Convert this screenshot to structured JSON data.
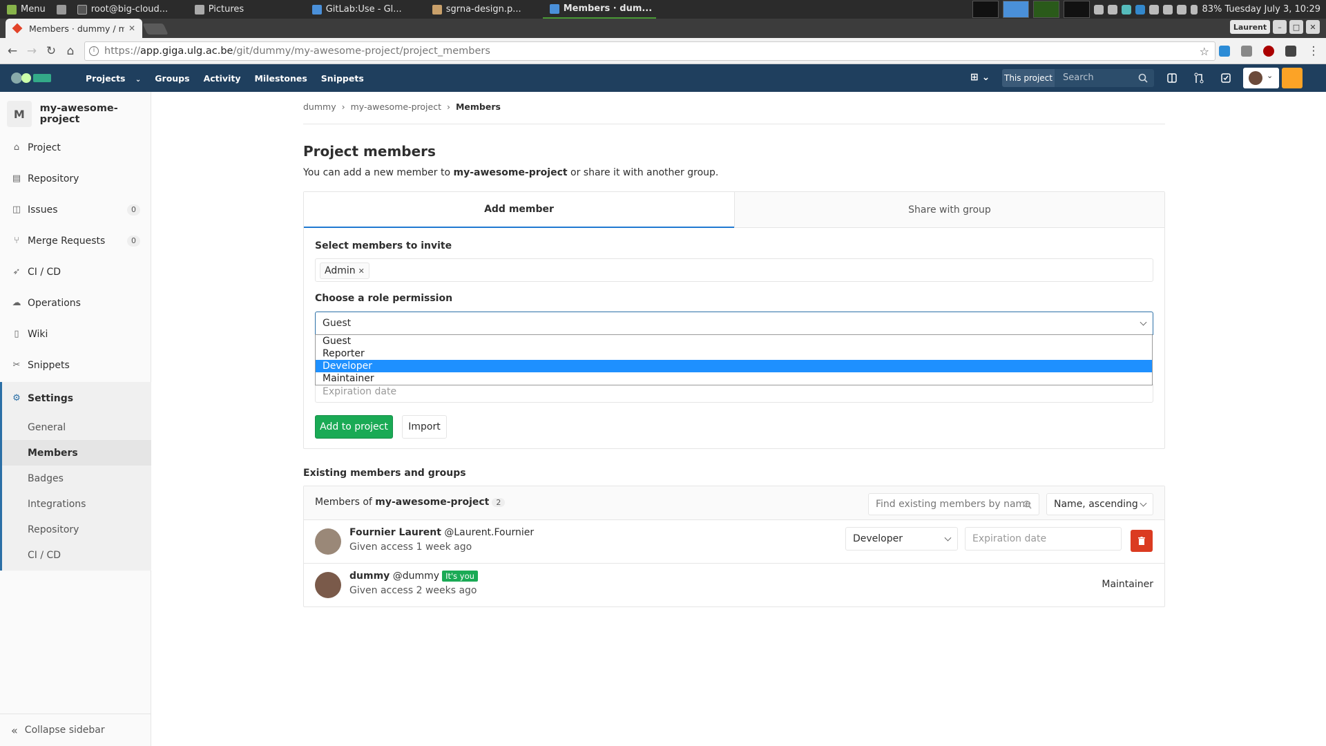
{
  "os_bar": {
    "menu_label": "Menu",
    "tasks": [
      "root@big-cloud...",
      "Pictures",
      "GitLab:Use - Gl...",
      "sgrna-design.p...",
      "Members · dum..."
    ],
    "status": "83%  Tuesday July  3, 10:29",
    "user_badge": "Laurent"
  },
  "browser": {
    "tab_title": "Members · dummy / my",
    "url_prefix": "https://",
    "url_host": "app.giga.ulg.ac.be",
    "url_path": "/git/dummy/my-awesome-project/project_members"
  },
  "header": {
    "nav": [
      "Projects",
      "Groups",
      "Activity",
      "Milestones",
      "Snippets"
    ],
    "this_project": "This project",
    "search_placeholder": "Search"
  },
  "sidebar": {
    "avatar_letter": "M",
    "project_name": "my-awesome-project",
    "items": [
      {
        "label": "Project",
        "icon": "home-icon"
      },
      {
        "label": "Repository",
        "icon": "book-icon"
      },
      {
        "label": "Issues",
        "icon": "issues-icon",
        "badge": "0"
      },
      {
        "label": "Merge Requests",
        "icon": "merge-request-icon",
        "badge": "0"
      },
      {
        "label": "CI / CD",
        "icon": "rocket-icon"
      },
      {
        "label": "Operations",
        "icon": "cloud-gear-icon"
      },
      {
        "label": "Wiki",
        "icon": "book-open-icon"
      },
      {
        "label": "Snippets",
        "icon": "scissors-icon"
      }
    ],
    "settings_label": "Settings",
    "settings_items": [
      "General",
      "Members",
      "Badges",
      "Integrations",
      "Repository",
      "CI / CD"
    ],
    "active_settings_item": "Members",
    "collapse_label": "Collapse sidebar"
  },
  "breadcrumb": [
    "dummy",
    "my-awesome-project",
    "Members"
  ],
  "page": {
    "title": "Project members",
    "desc_before": "You can add a new member to ",
    "desc_project": "my-awesome-project",
    "desc_after": " or share it with another group."
  },
  "tabs": [
    "Add member",
    "Share with group"
  ],
  "form": {
    "select_label": "Select members to invite",
    "selected_token": "Admin",
    "role_label": "Choose a role permission",
    "role_value": "Guest",
    "role_options": [
      "Guest",
      "Reporter",
      "Developer",
      "Maintainer"
    ],
    "highlighted_option": "Developer",
    "expiration_placeholder": "Expiration date",
    "add_button": "Add to project",
    "import_button": "Import"
  },
  "existing": {
    "section_title": "Existing members and groups",
    "members_of": "Members of ",
    "project": "my-awesome-project",
    "count": "2",
    "find_placeholder": "Find existing members by name",
    "sort_label": "Name, ascending",
    "members": [
      {
        "name": "Fournier Laurent",
        "handle": "@Laurent.Fournier",
        "access": "Given access 1 week ago",
        "role": "Developer",
        "expiration_placeholder": "Expiration date"
      },
      {
        "name": "dummy",
        "handle": "@dummy",
        "you_badge": "It's you",
        "access": "Given access 2 weeks ago",
        "role": "Maintainer"
      }
    ]
  },
  "colors": {
    "header": "#1f3f5e",
    "accent": "#1f78d1",
    "success": "#1aaa55",
    "danger": "#db3b21",
    "highlight": "#1e90ff"
  }
}
